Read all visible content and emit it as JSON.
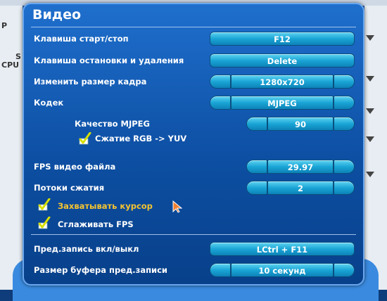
{
  "dialog": {
    "title": "Видео"
  },
  "rows": {
    "hotkey_start_stop": {
      "label": "Клавиша старт/стоп",
      "value": "F12"
    },
    "hotkey_stop_delete": {
      "label": "Клавиша остановки и удаления",
      "value": "Delete"
    },
    "frame_size": {
      "label": "Изменить размер кадра",
      "value": "1280x720"
    },
    "codec": {
      "label": "Кодек",
      "value": "MJPEG"
    },
    "mjpeg_quality": {
      "label": "Качество MJPEG",
      "value": "90"
    },
    "rgb_yuv": {
      "label": "Сжатие RGB -> YUV",
      "checked": true
    },
    "fps_video": {
      "label": "FPS видео файла",
      "value": "29.97"
    },
    "compression_threads": {
      "label": "Потоки сжатия",
      "value": "2"
    },
    "capture_cursor": {
      "label": "Захватывать курсор",
      "checked": true
    },
    "smooth_fps": {
      "label": "Сглаживать FPS",
      "checked": true
    },
    "prerecord_toggle": {
      "label": "Пред.запись вкл/выкл",
      "value": "LCtrl + F11"
    },
    "prerecord_buffer": {
      "label": "Размер буфера пред.записи",
      "value": "10 секунд"
    }
  },
  "background": {
    "left_text_top": "P",
    "left_text_mid1": "S",
    "left_text_mid2": "CPU"
  },
  "colors": {
    "accent": "#1aa5d6",
    "highlight": "#f4c430",
    "check": "#d8e000"
  }
}
